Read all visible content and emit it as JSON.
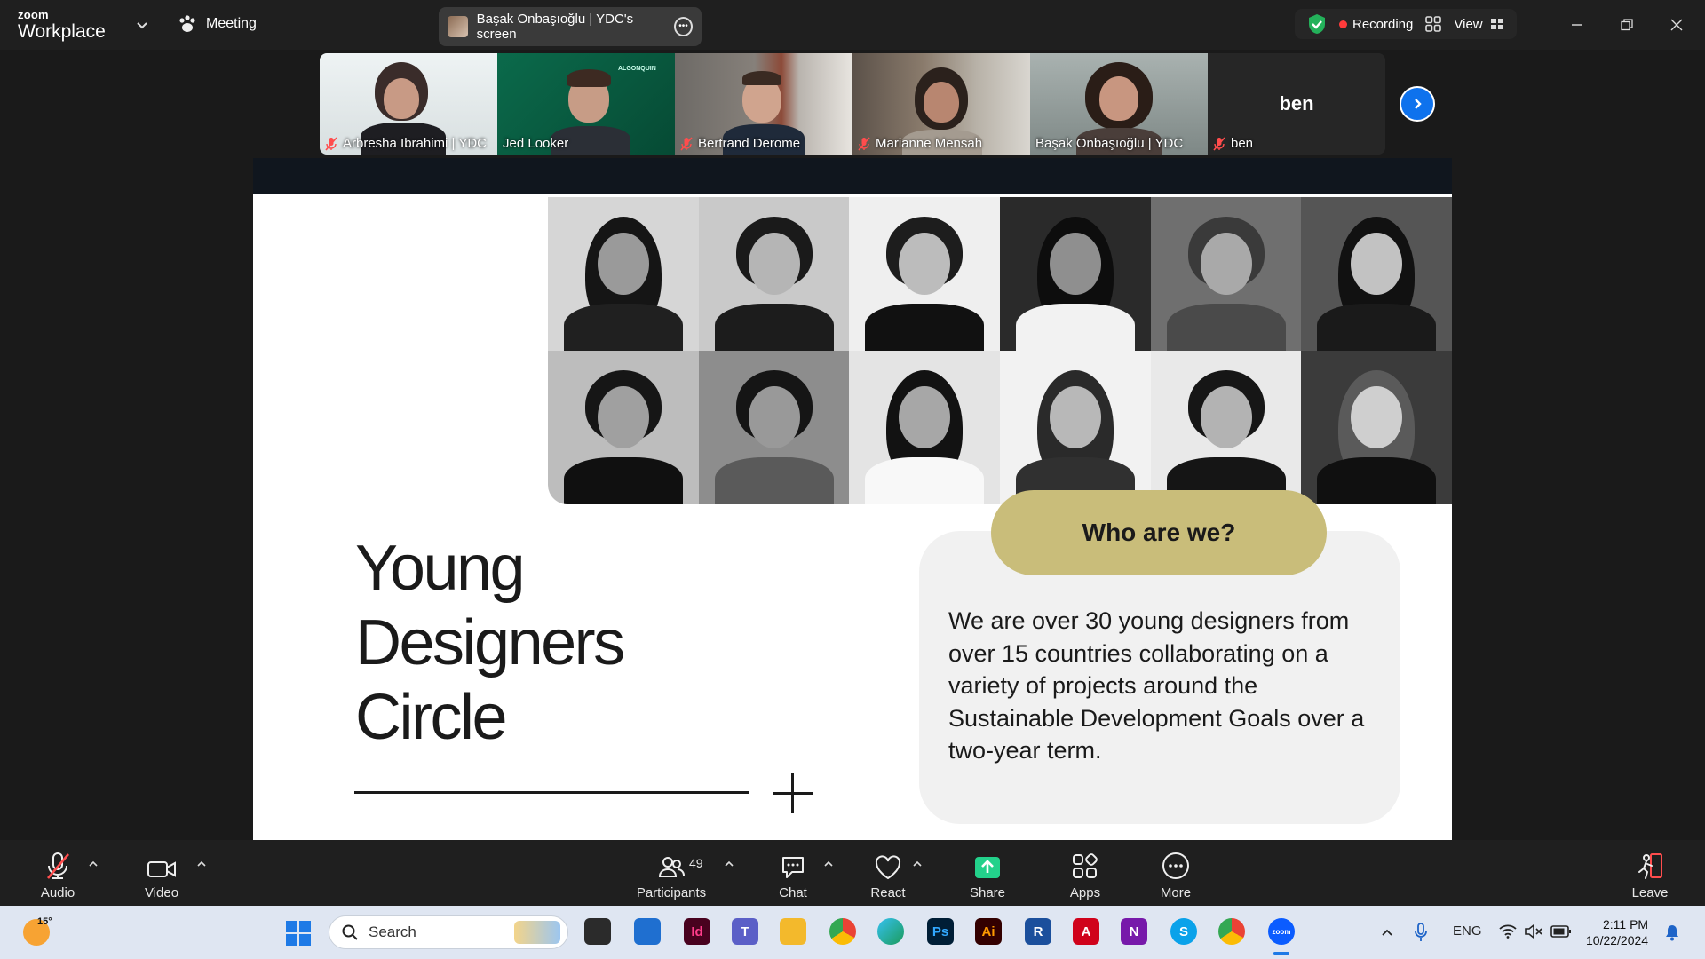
{
  "app": {
    "brand_small": "zoom",
    "brand": "Workplace",
    "meeting_label": "Meeting"
  },
  "share_pill": {
    "label": "Başak Onbaşıoğlu | YDC's screen"
  },
  "recording": {
    "label": "Recording",
    "view_label": "View"
  },
  "participants": [
    {
      "name": "Arbresha Ibrahimi | YDC",
      "muted": true
    },
    {
      "name": "Jed Looker",
      "muted": false,
      "logo": "ALGONQUIN"
    },
    {
      "name": "Bertrand Derome",
      "muted": true
    },
    {
      "name": "Marianne Mensah",
      "muted": true
    },
    {
      "name": "Başak Onbaşıoğlu | YDC",
      "muted": false,
      "active": true
    },
    {
      "name": "ben",
      "muted": true,
      "avatar_text": "ben"
    }
  ],
  "slide": {
    "title_lines": [
      "Young",
      "Designers",
      "Circle"
    ],
    "pill": "Who are we?",
    "body": "We are over 30 young designers from over 15 countries collaborating on a variety of projects around the Sustainable Development Goals over a two-year term.",
    "photo_count": 12
  },
  "toolbar": {
    "audio": "Audio",
    "video": "Video",
    "participants": "Participants",
    "participants_count": "49",
    "chat": "Chat",
    "react": "React",
    "share": "Share",
    "apps": "Apps",
    "more": "More",
    "leave": "Leave"
  },
  "taskbar": {
    "temperature": "15°",
    "search_placeholder": "Search",
    "apps": [
      "task-view",
      "store",
      "indesign",
      "teams",
      "file-explorer",
      "chrome",
      "edge",
      "photoshop",
      "illustrator",
      "revit",
      "autocad",
      "onenote",
      "skype",
      "chrome-profile",
      "zoom"
    ],
    "language": "ENG",
    "time": "2:11 PM",
    "date": "10/22/2024"
  },
  "colors": {
    "accent": "#0e72ed",
    "active_tile": "#23d18b",
    "share_green": "#23d18b",
    "pill_gold": "#c9bd7a",
    "recording_dot": "#ff3b3b"
  }
}
